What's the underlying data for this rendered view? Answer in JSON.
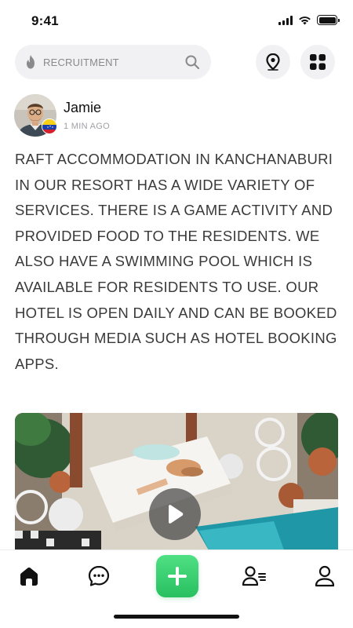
{
  "status_bar": {
    "time": "9:41",
    "icons": [
      "cellular-signal-icon",
      "wifi-icon",
      "battery-icon"
    ]
  },
  "search": {
    "placeholder": "RECRUITMENT",
    "leading_icon": "fire-icon",
    "trailing_icon": "search-icon"
  },
  "top_actions": [
    {
      "name": "location-button",
      "icon": "location-pin-icon"
    },
    {
      "name": "menu-grid-button",
      "icon": "grid-icon"
    }
  ],
  "post": {
    "author": "Jamie",
    "time_ago": "1 MIN AGO",
    "flag": "venezuela-flag-icon",
    "body": "RAFT ACCOMMODATION IN KANCHANABURI IN OUR RESORT HAS A WIDE VARIETY OF SERVICES. THERE IS A GAME ACTIVITY AND PROVIDED FOOD TO THE RESIDENTS. WE ALSO HAVE A SWIMMING POOL WHICH IS AVAILABLE FOR RESIDENTS TO USE. OUR HOTEL IS OPEN DAILY AND CAN BE BOOKED THROUGH MEDIA SUCH AS HOTEL BOOKING APPS.",
    "media": {
      "type": "video",
      "icon": "play-icon"
    }
  },
  "bottom_nav": [
    {
      "name": "home",
      "icon": "home-icon",
      "active": true
    },
    {
      "name": "chat",
      "icon": "chat-bubble-icon"
    },
    {
      "name": "add",
      "icon": "plus-icon"
    },
    {
      "name": "contacts",
      "icon": "contacts-list-icon"
    },
    {
      "name": "profile",
      "icon": "user-icon"
    }
  ],
  "colors": {
    "accent_green": "#3ad070",
    "search_bg": "#f1f1f3",
    "text_primary": "#3a3a3a"
  }
}
